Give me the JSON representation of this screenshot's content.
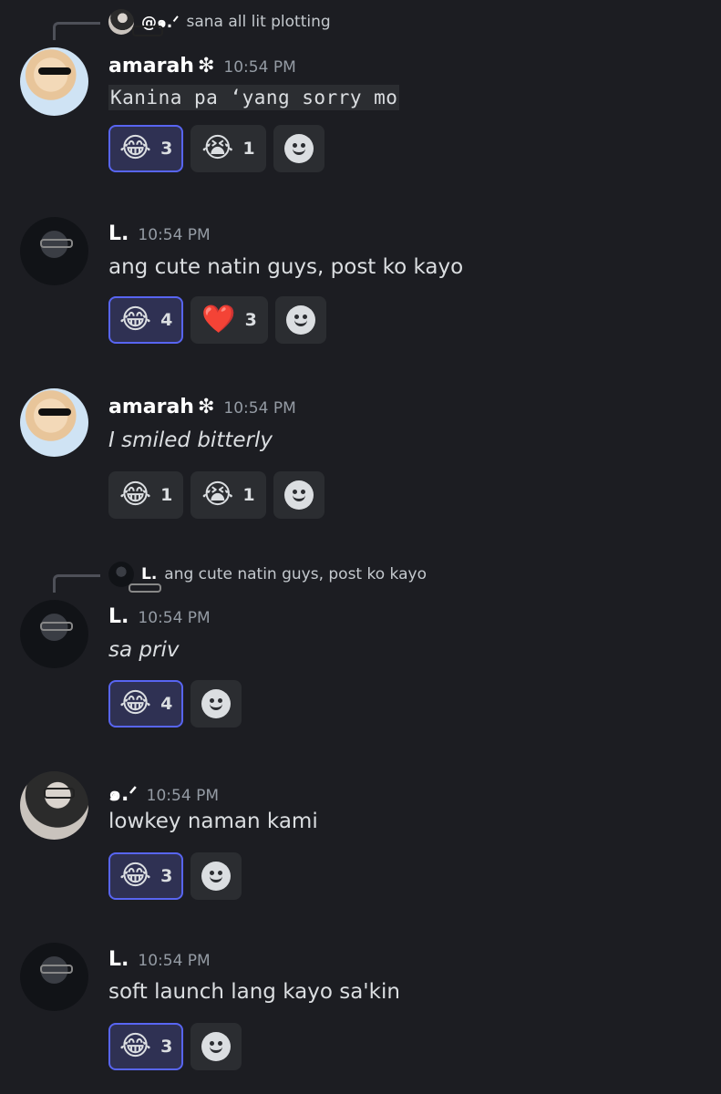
{
  "messages": [
    {
      "reply": {
        "author": "@๑.ᐟ",
        "text": "sana all lit plotting"
      },
      "author": "amarah",
      "decoration": "❇",
      "time": "10:54 PM",
      "text": "Kanina pa ‘yang sorry mo",
      "reactions": [
        {
          "emoji": "😂",
          "count": "3",
          "me": true
        },
        {
          "emoji": "😭",
          "count": "1",
          "me": false
        }
      ]
    },
    {
      "author": "L.",
      "time": "10:54 PM",
      "text": "ang cute natin guys, post ko kayo",
      "reactions": [
        {
          "emoji": "😂",
          "count": "4",
          "me": true
        },
        {
          "emoji": "❤️",
          "count": "3",
          "me": false
        }
      ]
    },
    {
      "author": "amarah",
      "decoration": "❇",
      "time": "10:54 PM",
      "text": "I smiled bitterly",
      "reactions": [
        {
          "emoji": "😂",
          "count": "1",
          "me": false
        },
        {
          "emoji": "😭",
          "count": "1",
          "me": false
        }
      ]
    },
    {
      "reply": {
        "author": "L.",
        "text": "ang cute natin guys, post ko kayo"
      },
      "author": "L.",
      "time": "10:54 PM",
      "text": "sa priv",
      "reactions": [
        {
          "emoji": "😂",
          "count": "4",
          "me": true
        }
      ]
    },
    {
      "author": "๑.ᐟ",
      "time": "10:54 PM",
      "text": "lowkey naman kami",
      "reactions": [
        {
          "emoji": "😂",
          "count": "3",
          "me": true
        }
      ]
    },
    {
      "author": "L.",
      "time": "10:54 PM",
      "text": "soft launch lang kayo sa'kin",
      "reactions": [
        {
          "emoji": "😂",
          "count": "3",
          "me": true
        }
      ]
    }
  ],
  "add_reaction_icon": "add-reaction-smiley-icon"
}
